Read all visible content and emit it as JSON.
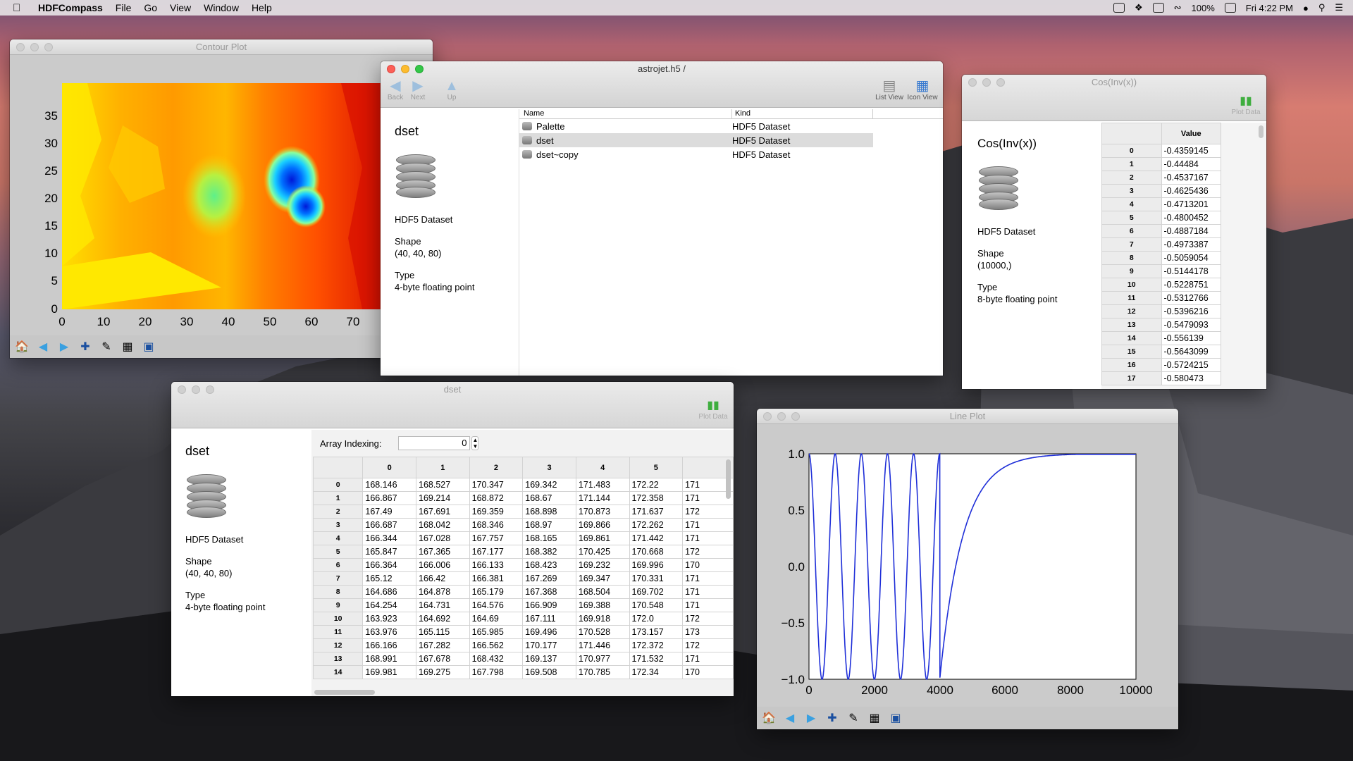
{
  "menubar": {
    "app": "HDFCompass",
    "items": [
      "File",
      "Go",
      "View",
      "Window",
      "Help"
    ],
    "battery": "100%",
    "time": "Fri 4:22 PM"
  },
  "contour": {
    "title": "Contour Plot",
    "yticks": [
      "35",
      "30",
      "25",
      "20",
      "15",
      "10",
      "5",
      "0"
    ],
    "xticks": [
      "0",
      "10",
      "20",
      "30",
      "40",
      "50",
      "60",
      "70"
    ]
  },
  "browser": {
    "title": "astrojet.h5 /",
    "back": "Back",
    "next": "Next",
    "up": "Up",
    "list_view": "List View",
    "icon_view": "Icon View",
    "col_name": "Name",
    "col_kind": "Kind",
    "rows": [
      {
        "name": "Palette",
        "kind": "HDF5 Dataset"
      },
      {
        "name": "dset",
        "kind": "HDF5 Dataset"
      },
      {
        "name": "dset~copy",
        "kind": "HDF5 Dataset"
      }
    ],
    "info": {
      "name": "dset",
      "kind": "HDF5 Dataset",
      "shape_label": "Shape",
      "shape": "(40, 40, 80)",
      "type_label": "Type",
      "type": "4-byte floating point"
    }
  },
  "cos": {
    "title": "Cos(Inv(x))",
    "plot_data": "Plot Data",
    "value_header": "Value",
    "info": {
      "name": "Cos(Inv(x))",
      "kind": "HDF5 Dataset",
      "shape_label": "Shape",
      "shape": "(10000,)",
      "type_label": "Type",
      "type": "8-byte floating point"
    },
    "rows": [
      [
        "0",
        "-0.4359145"
      ],
      [
        "1",
        "-0.44484"
      ],
      [
        "2",
        "-0.4537167"
      ],
      [
        "3",
        "-0.4625436"
      ],
      [
        "4",
        "-0.4713201"
      ],
      [
        "5",
        "-0.4800452"
      ],
      [
        "6",
        "-0.4887184"
      ],
      [
        "7",
        "-0.4973387"
      ],
      [
        "8",
        "-0.5059054"
      ],
      [
        "9",
        "-0.5144178"
      ],
      [
        "10",
        "-0.5228751"
      ],
      [
        "11",
        "-0.5312766"
      ],
      [
        "12",
        "-0.5396216"
      ],
      [
        "13",
        "-0.5479093"
      ],
      [
        "14",
        "-0.556139"
      ],
      [
        "15",
        "-0.5643099"
      ],
      [
        "16",
        "-0.5724215"
      ],
      [
        "17",
        "-0.580473"
      ]
    ]
  },
  "dset": {
    "title": "dset",
    "plot_data": "Plot Data",
    "array_indexing_label": "Array Indexing:",
    "array_index_value": "0",
    "info": {
      "name": "dset",
      "kind": "HDF5 Dataset",
      "shape_label": "Shape",
      "shape": "(40, 40, 80)",
      "type_label": "Type",
      "type": "4-byte floating point"
    },
    "columns": [
      "0",
      "1",
      "2",
      "3",
      "4",
      "5"
    ],
    "rows": [
      [
        "0",
        "168.146",
        "168.527",
        "170.347",
        "169.342",
        "171.483",
        "172.22",
        "171"
      ],
      [
        "1",
        "166.867",
        "169.214",
        "168.872",
        "168.67",
        "171.144",
        "172.358",
        "171"
      ],
      [
        "2",
        "167.49",
        "167.691",
        "169.359",
        "168.898",
        "170.873",
        "171.637",
        "172"
      ],
      [
        "3",
        "166.687",
        "168.042",
        "168.346",
        "168.97",
        "169.866",
        "172.262",
        "171"
      ],
      [
        "4",
        "166.344",
        "167.028",
        "167.757",
        "168.165",
        "169.861",
        "171.442",
        "171"
      ],
      [
        "5",
        "165.847",
        "167.365",
        "167.177",
        "168.382",
        "170.425",
        "170.668",
        "172"
      ],
      [
        "6",
        "166.364",
        "166.006",
        "166.133",
        "168.423",
        "169.232",
        "169.996",
        "170"
      ],
      [
        "7",
        "165.12",
        "166.42",
        "166.381",
        "167.269",
        "169.347",
        "170.331",
        "171"
      ],
      [
        "8",
        "164.686",
        "164.878",
        "165.179",
        "167.368",
        "168.504",
        "169.702",
        "171"
      ],
      [
        "9",
        "164.254",
        "164.731",
        "164.576",
        "166.909",
        "169.388",
        "170.548",
        "171"
      ],
      [
        "10",
        "163.923",
        "164.692",
        "164.69",
        "167.111",
        "169.918",
        "172.0",
        "172"
      ],
      [
        "11",
        "163.976",
        "165.115",
        "165.985",
        "169.496",
        "170.528",
        "173.157",
        "173"
      ],
      [
        "12",
        "166.166",
        "167.282",
        "166.562",
        "170.177",
        "171.446",
        "172.372",
        "172"
      ],
      [
        "13",
        "168.991",
        "167.678",
        "168.432",
        "169.137",
        "170.977",
        "171.532",
        "171"
      ],
      [
        "14",
        "169.981",
        "169.275",
        "167.798",
        "169.508",
        "170.785",
        "172.34",
        "170"
      ]
    ]
  },
  "lineplot": {
    "title": "Line Plot",
    "yticks": [
      "1.0",
      "0.5",
      "0.0",
      "−0.5",
      "−1.0"
    ],
    "xticks": [
      "0",
      "2000",
      "4000",
      "6000",
      "8000",
      "10000"
    ]
  },
  "chart_data": [
    {
      "type": "line",
      "title": "",
      "xlabel": "",
      "ylabel": "",
      "xlim": [
        0,
        10000
      ],
      "ylim": [
        -1,
        1
      ],
      "series": [
        {
          "values_desc": "y = cos(1000/x) approx",
          "x": [
            0,
            400,
            600,
            800,
            1000,
            1200,
            1400,
            1600,
            1800,
            2000,
            2200,
            2500,
            2800,
            3100,
            3400,
            3700,
            4000,
            4300,
            4600,
            5000,
            5500,
            6000,
            7000,
            8000,
            9000,
            10000
          ],
          "y": [
            1,
            -1,
            1,
            -1,
            1,
            -1,
            1,
            -1,
            1,
            -1,
            1,
            -1,
            1,
            -1,
            1,
            -1,
            -1,
            0.2,
            0.55,
            0.72,
            0.83,
            0.89,
            0.94,
            0.97,
            0.985,
            0.99
          ]
        }
      ]
    },
    {
      "type": "heatmap",
      "title": "",
      "xlim": [
        0,
        78
      ],
      "ylim": [
        0,
        39
      ]
    }
  ]
}
